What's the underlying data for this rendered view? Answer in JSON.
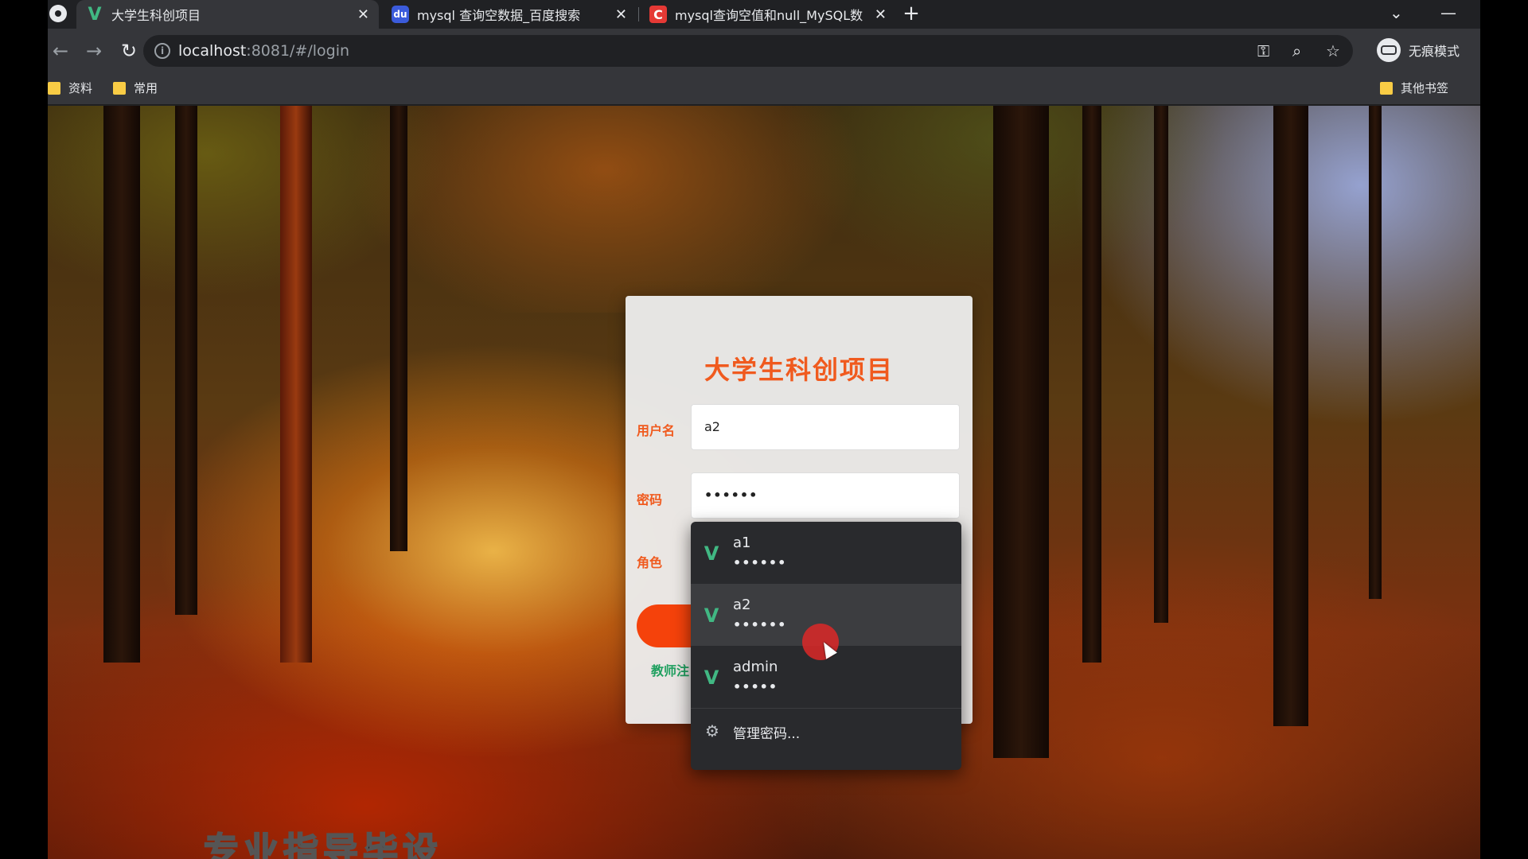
{
  "browser": {
    "tabs": [
      {
        "title": "大学生科创项目",
        "favicon": "vue-logo-icon",
        "active": true
      },
      {
        "title": "mysql 查询空数据_百度搜索",
        "favicon": "baidu-paw-icon",
        "active": false
      },
      {
        "title": "mysql查询空值和null_MySQL数",
        "favicon": "csdn-logo-icon",
        "active": false
      }
    ],
    "address": {
      "host": "localhost",
      "path": ":8081/#/login"
    },
    "profile_label": "无痕模式",
    "bookmarks": [
      "资料",
      "常用"
    ],
    "other_bookmarks": "其他书签",
    "colors": {
      "chrome_dark": "#202124",
      "chrome_toolbar": "#35363a",
      "folder": "#f9cc45"
    }
  },
  "login": {
    "title": "大学生科创项目",
    "username_label": "用户名",
    "username_value": "a2",
    "password_label": "密码",
    "password_value": "••••••",
    "role_label": "角色",
    "teacher_link": "教师注",
    "colors": {
      "accent": "#f05a1e",
      "button": "#f5420b",
      "link": "#20a060"
    }
  },
  "autofill": {
    "items": [
      {
        "user": "a1",
        "pass": "••••••",
        "icon": "vue-logo-icon"
      },
      {
        "user": "a2",
        "pass": "••••••",
        "icon": "vue-logo-icon",
        "hover": true
      },
      {
        "user": "admin",
        "pass": "•••••",
        "icon": "vue-logo-icon"
      }
    ],
    "manage_label": "管理密码..."
  },
  "overlay_caption": "专业指导毕设"
}
